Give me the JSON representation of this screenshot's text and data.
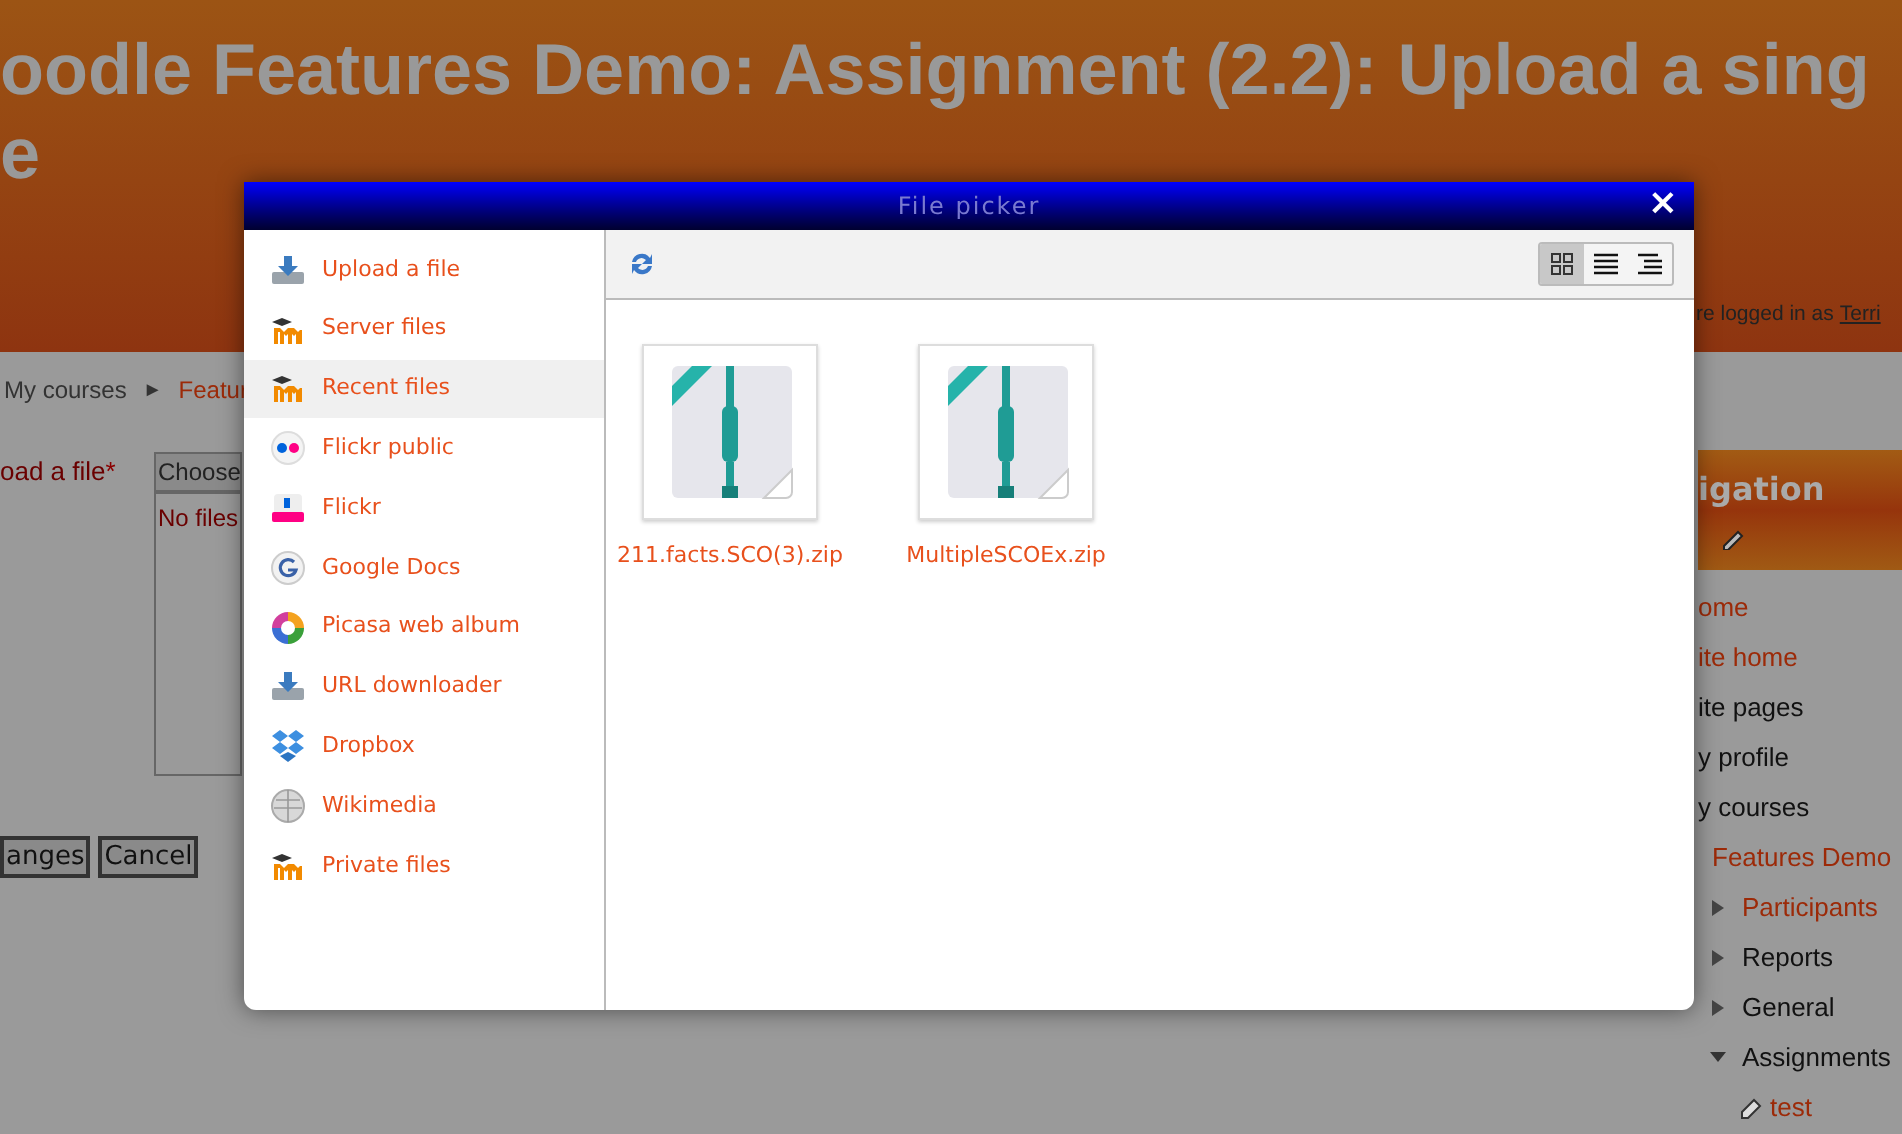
{
  "page": {
    "title_lines": [
      "oodle Features Demo: Assignment (2.2): Upload a sing",
      "e"
    ],
    "login_text": "re logged in as",
    "login_user": "Terri",
    "breadcrumb": [
      {
        "label": "My courses",
        "link": false
      },
      {
        "label": "Featur",
        "link": true
      }
    ],
    "breadcrumb_separator": "►",
    "form": {
      "label": "oad a file",
      "required_mark": "*",
      "choose_button": "Choose",
      "files_text": "No files",
      "buttons": [
        "anges",
        "Cancel"
      ]
    },
    "navigation": {
      "title": "igation",
      "items": [
        {
          "label": "ome",
          "link": true
        },
        {
          "label": "ite home",
          "link": true
        },
        {
          "label": "ite pages",
          "link": false
        },
        {
          "label": "y profile",
          "link": false
        },
        {
          "label": "y courses",
          "link": false,
          "children": [
            {
              "label": "Features Demo",
              "link": true,
              "children": [
                {
                  "label": "Participants",
                  "link": true,
                  "expanded": false
                },
                {
                  "label": "Reports",
                  "link": false,
                  "expanded": false
                },
                {
                  "label": "General",
                  "link": false,
                  "expanded": false
                },
                {
                  "label": "Assignments",
                  "link": false,
                  "expanded": true,
                  "children": [
                    {
                      "label": "test",
                      "link": true,
                      "kind": "assignment"
                    }
                  ]
                }
              ]
            }
          ]
        }
      ]
    }
  },
  "file_picker": {
    "title": "File picker",
    "close": "×",
    "repositories": [
      {
        "label": "Upload a file",
        "kind": "upload",
        "selected": false
      },
      {
        "label": "Server files",
        "kind": "moodle",
        "selected": false
      },
      {
        "label": "Recent files",
        "kind": "moodle",
        "selected": true
      },
      {
        "label": "Flickr public",
        "kind": "flickr_public",
        "selected": false
      },
      {
        "label": "Flickr",
        "kind": "flickr",
        "selected": false
      },
      {
        "label": "Google Docs",
        "kind": "google",
        "selected": false
      },
      {
        "label": "Picasa web album",
        "kind": "picasa",
        "selected": false
      },
      {
        "label": "URL downloader",
        "kind": "upload",
        "selected": false
      },
      {
        "label": "Dropbox",
        "kind": "dropbox",
        "selected": false
      },
      {
        "label": "Wikimedia",
        "kind": "wikimedia",
        "selected": false
      },
      {
        "label": "Private files",
        "kind": "moodle",
        "selected": false
      }
    ],
    "view_modes": [
      {
        "kind": "icons",
        "selected": true
      },
      {
        "kind": "list",
        "selected": false
      },
      {
        "kind": "tree",
        "selected": false
      }
    ],
    "files": [
      {
        "name": "211.facts.SCO(3).zip"
      },
      {
        "name": "MultipleSCOEx.zip"
      }
    ]
  }
}
